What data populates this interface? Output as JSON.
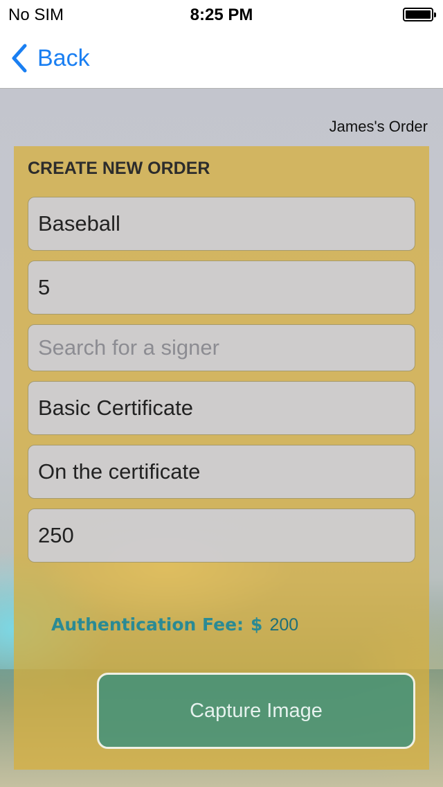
{
  "status_bar": {
    "carrier": "No SIM",
    "time": "8:25 PM"
  },
  "nav": {
    "back_label": "Back"
  },
  "order_owner": "James's Order",
  "form": {
    "title": "CREATE NEW ORDER",
    "fields": [
      {
        "value": "Baseball",
        "placeholder": ""
      },
      {
        "value": "5",
        "placeholder": ""
      },
      {
        "value": "",
        "placeholder": "Search for a signer"
      },
      {
        "value": "Basic Certificate",
        "placeholder": ""
      },
      {
        "value": "On the certificate",
        "placeholder": ""
      },
      {
        "value": "250",
        "placeholder": ""
      }
    ],
    "fee_label": "Authentication Fee:",
    "fee_currency": "$",
    "fee_value": "200",
    "capture_label": "Capture Image"
  },
  "colors": {
    "accent": "#1a7ff2",
    "panel": "#d7af3c",
    "fee_text": "#2a8a94",
    "capture_button": "#288c82"
  }
}
